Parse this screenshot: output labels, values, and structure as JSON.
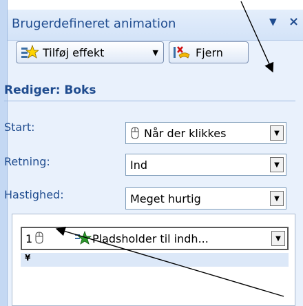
{
  "pane": {
    "title": "Brugerdefineret animation",
    "dropdown_glyph": "▼",
    "close_glyph": "×"
  },
  "toolbar": {
    "add_effect_label": "Tilføj effekt",
    "add_effect_icon": "star-icon",
    "remove_label": "Fjern",
    "remove_icon": "remove-effect-icon"
  },
  "edit": {
    "heading": "Rediger: Boks",
    "start_label": "Start:",
    "start_value": "Når der klikkes",
    "direction_label": "Retning:",
    "direction_value": "Ind",
    "speed_label": "Hastighed:",
    "speed_value": "Meget hurtig"
  },
  "animation_list": {
    "items": [
      {
        "number": "1",
        "trigger_icon": "mouse-icon",
        "effect_icon": "star-icon",
        "name": "Pladsholder til indh..."
      }
    ],
    "expand_glyph": "¥"
  },
  "colors": {
    "accent": "#1f4c8f",
    "pane_bg": "#e9f1fc"
  }
}
